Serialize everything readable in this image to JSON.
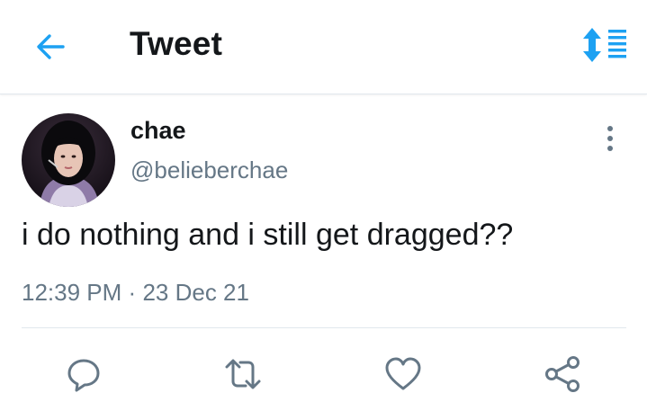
{
  "header": {
    "title": "Tweet",
    "back_icon": "arrow-left-icon",
    "sort_icon": "sort-toggle-icon"
  },
  "tweet": {
    "display_name": "chae",
    "handle": "@belieberchae",
    "text": "i do nothing and i still get dragged??",
    "time": "12:39 PM",
    "separator": "·",
    "date": "23 Dec 21",
    "more_icon": "more-vertical-icon"
  },
  "actions": [
    {
      "name": "reply",
      "icon": "reply-icon"
    },
    {
      "name": "retweet",
      "icon": "retweet-icon"
    },
    {
      "name": "like",
      "icon": "heart-icon"
    },
    {
      "name": "share",
      "icon": "share-icon"
    }
  ],
  "colors": {
    "accent": "#1da1f2",
    "text_primary": "#14171a",
    "text_secondary": "#657786",
    "icon_gray": "#657786",
    "divider": "#e1e8ed"
  }
}
